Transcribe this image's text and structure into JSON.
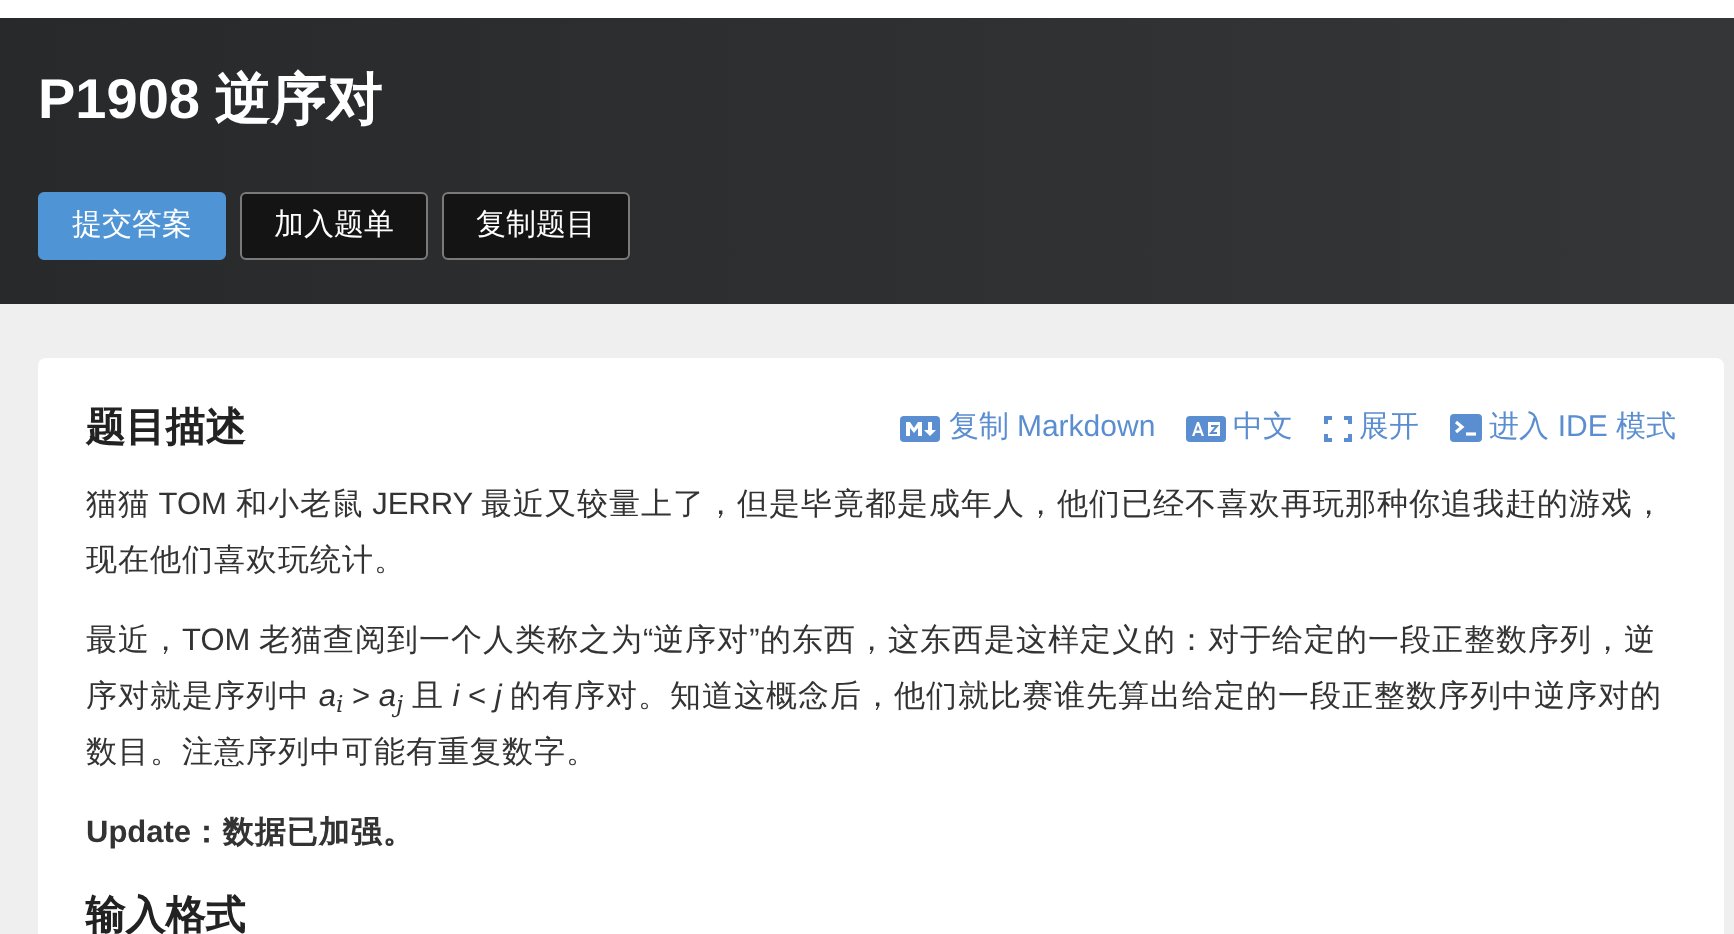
{
  "header": {
    "title": "P1908 逆序对",
    "buttons": [
      {
        "label": "提交答案",
        "primary": true
      },
      {
        "label": "加入题单",
        "primary": false
      },
      {
        "label": "复制题目",
        "primary": false
      }
    ]
  },
  "card": {
    "heading": "题目描述",
    "actions": [
      {
        "kind": "markdown",
        "label": "复制 Markdown"
      },
      {
        "kind": "language",
        "label": "中文"
      },
      {
        "kind": "expand",
        "label": "展开"
      },
      {
        "kind": "ide",
        "label": "进入 IDE 模式"
      }
    ],
    "paragraphs": [
      "猫猫 TOM 和小老鼠 JERRY 最近又较量上了，但是毕竟都是成年人，他们已经不喜欢再玩那种你追我赶的游戏，现在他们喜欢玩统计。",
      "最近，TOM 老猫查阅到一个人类称之为“逆序对”的东西，这东西是这样定义的：对于给定的一段正整数序列，逆序对就是序列中 *a*$_{i}$ > *a*$_{j}$ 且 *i* < *j* 的有序对。知道这概念后，他们就比赛谁先算出给定的一段正整数序列中逆序对的数目。注意序列中可能有重复数字。",
      "**Update：数据已加强。**"
    ],
    "next_heading": "输入格式"
  }
}
